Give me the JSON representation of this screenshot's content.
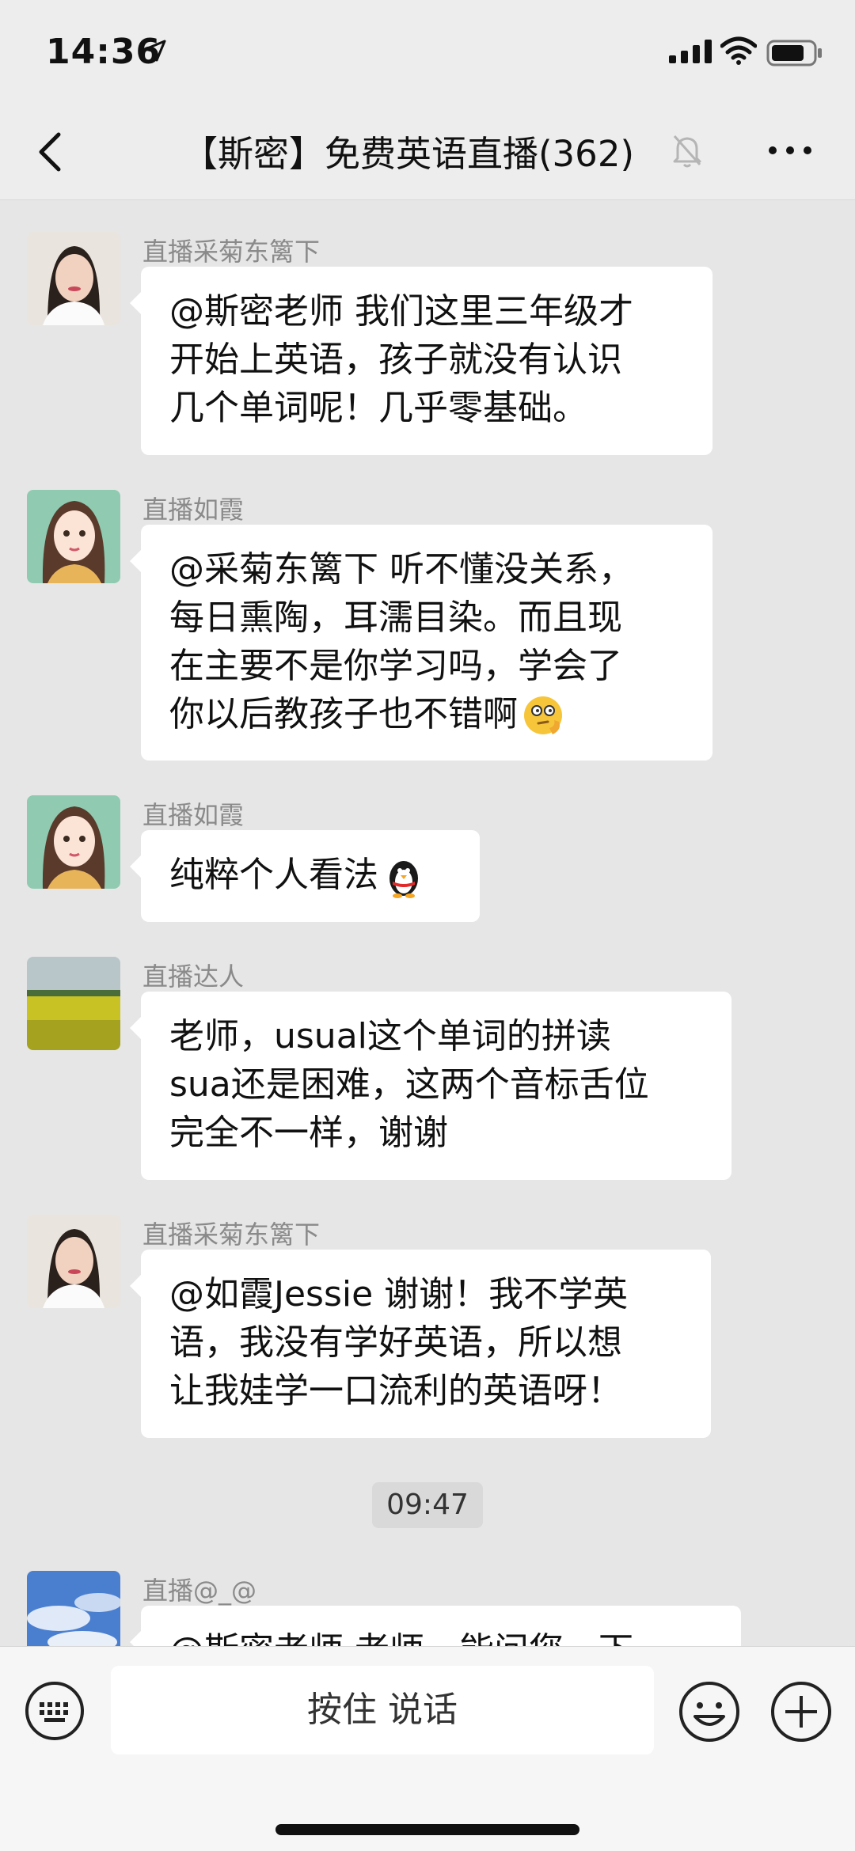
{
  "status_bar": {
    "time": "14:36"
  },
  "header": {
    "title": "【斯密】免费英语直播(362)"
  },
  "messages": [
    {
      "sender": "直播采菊东篱下",
      "lines": [
        "@斯密老师 我们这里三年级才",
        "开始上英语，孩子就没有认识",
        "几个单词呢！几乎零基础。"
      ]
    },
    {
      "sender": "直播如霞",
      "lines": [
        "@采菊东篱下 听不懂没关系，",
        "每日熏陶，耳濡目染。而且现",
        "在主要不是你学习吗，学会了",
        "你以后教孩子也不错啊"
      ]
    },
    {
      "sender": "直播如霞",
      "lines": [
        "纯粹个人看法"
      ]
    },
    {
      "sender": "直播达人",
      "lines": [
        "老师，usual这个单词的拼读",
        "sua还是困难，这两个音标舌位",
        "完全不一样，谢谢"
      ]
    },
    {
      "sender": "直播采菊东篱下",
      "lines": [
        "@如霞Jessie 谢谢！我不学英",
        "语，我没有学好英语，所以想",
        "让我娃学一口流利的英语呀！"
      ]
    },
    {
      "sender": "直播@_@",
      "lines": [
        "@斯密老师 老师，能问您一下"
      ]
    }
  ],
  "timestamp": "09:47",
  "input_bar": {
    "voice_label": "按住 说话"
  }
}
